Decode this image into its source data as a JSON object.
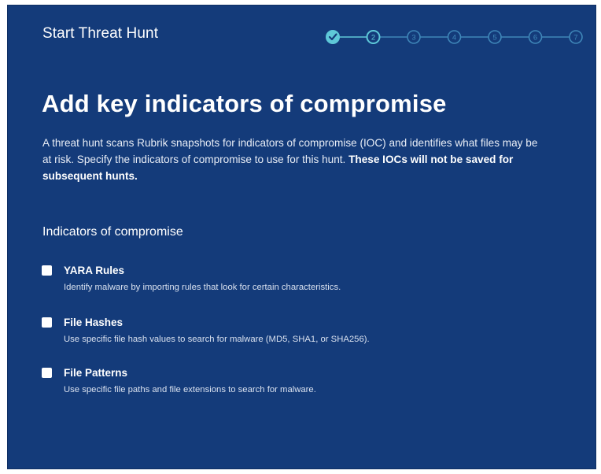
{
  "header": {
    "title": "Start Threat Hunt"
  },
  "stepper": {
    "current_step": 2,
    "total_steps": 7,
    "steps": [
      {
        "label": "",
        "state": "complete"
      },
      {
        "label": "2",
        "state": "current"
      },
      {
        "label": "3",
        "state": "upcoming"
      },
      {
        "label": "4",
        "state": "upcoming"
      },
      {
        "label": "5",
        "state": "upcoming"
      },
      {
        "label": "6",
        "state": "upcoming"
      },
      {
        "label": "7",
        "state": "upcoming"
      }
    ],
    "colors": {
      "complete": "#5ec8d8",
      "current": "#5ec8d8",
      "upcoming": "#3f86b8"
    }
  },
  "main": {
    "title": "Add key indicators of compromise",
    "description": "A threat hunt scans Rubrik snapshots for indicators of compromise (IOC) and identifies what files may be at risk. Specify the indicators of compromise to use for this hunt.",
    "description_emphasis": "These IOCs will not be saved for subsequent hunts."
  },
  "ioc_section": {
    "title": "Indicators of compromise",
    "options": [
      {
        "label": "YARA Rules",
        "description": "Identify malware by importing rules that look for certain characteristics.",
        "checked": false
      },
      {
        "label": "File Hashes",
        "description": "Use specific file hash values to search for malware (MD5, SHA1, or SHA256).",
        "checked": false
      },
      {
        "label": "File Patterns",
        "description": "Use specific file paths and file extensions to search for malware.",
        "checked": false
      }
    ]
  },
  "colors": {
    "background": "#143b7a",
    "text": "#ffffff",
    "accent": "#5ec8d8"
  }
}
